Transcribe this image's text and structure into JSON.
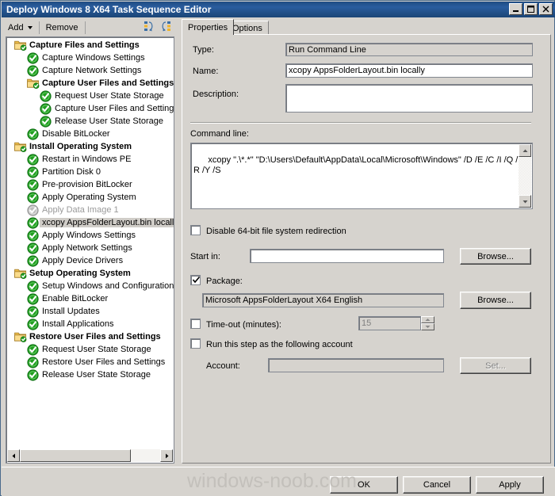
{
  "window": {
    "title": "Deploy Windows 8 X64 Task Sequence Editor",
    "minimize_label": "Minimize",
    "maximize_label": "Maximize",
    "close_label": "Close"
  },
  "toolbar": {
    "add_label": "Add",
    "remove_label": "Remove",
    "move_up_label": "Move Up",
    "move_down_label": "Move Down"
  },
  "tabs": [
    {
      "label": "Properties",
      "active": true
    },
    {
      "label": "Options",
      "active": false
    }
  ],
  "tree": {
    "items": [
      {
        "label": "Capture Files and Settings",
        "indent": 0,
        "icon": "folder-check-icon",
        "group": true,
        "state": "normal"
      },
      {
        "label": "Capture Windows Settings",
        "indent": 1,
        "icon": "green-check-icon",
        "group": false,
        "state": "normal"
      },
      {
        "label": "Capture Network Settings",
        "indent": 1,
        "icon": "green-check-icon",
        "group": false,
        "state": "normal"
      },
      {
        "label": "Capture User Files and Settings",
        "indent": 1,
        "icon": "folder-check-icon",
        "group": true,
        "state": "normal"
      },
      {
        "label": "Request User State Storage",
        "indent": 2,
        "icon": "green-check-icon",
        "group": false,
        "state": "normal"
      },
      {
        "label": "Capture User Files and Settings",
        "indent": 2,
        "icon": "green-check-icon",
        "group": false,
        "state": "normal"
      },
      {
        "label": "Release User State Storage",
        "indent": 2,
        "icon": "green-check-icon",
        "group": false,
        "state": "normal"
      },
      {
        "label": "Disable BitLocker",
        "indent": 1,
        "icon": "green-check-icon",
        "group": false,
        "state": "normal"
      },
      {
        "label": "Install Operating System",
        "indent": 0,
        "icon": "folder-check-icon",
        "group": true,
        "state": "normal"
      },
      {
        "label": "Restart in Windows PE",
        "indent": 1,
        "icon": "green-check-icon",
        "group": false,
        "state": "normal"
      },
      {
        "label": "Partition Disk 0",
        "indent": 1,
        "icon": "green-check-icon",
        "group": false,
        "state": "normal"
      },
      {
        "label": "Pre-provision BitLocker",
        "indent": 1,
        "icon": "green-check-icon",
        "group": false,
        "state": "normal"
      },
      {
        "label": "Apply Operating System",
        "indent": 1,
        "icon": "green-check-icon",
        "group": false,
        "state": "normal"
      },
      {
        "label": "Apply Data Image 1",
        "indent": 1,
        "icon": "gray-check-icon",
        "group": false,
        "state": "disabled"
      },
      {
        "label": "xcopy AppsFolderLayout.bin locally",
        "indent": 1,
        "icon": "green-check-icon",
        "group": false,
        "state": "selected"
      },
      {
        "label": "Apply Windows Settings",
        "indent": 1,
        "icon": "green-check-icon",
        "group": false,
        "state": "normal"
      },
      {
        "label": "Apply Network Settings",
        "indent": 1,
        "icon": "green-check-icon",
        "group": false,
        "state": "normal"
      },
      {
        "label": "Apply Device Drivers",
        "indent": 1,
        "icon": "green-check-icon",
        "group": false,
        "state": "normal"
      },
      {
        "label": "Setup Operating System",
        "indent": 0,
        "icon": "folder-check-icon",
        "group": true,
        "state": "normal"
      },
      {
        "label": "Setup Windows and Configuration",
        "indent": 1,
        "icon": "green-check-icon",
        "group": false,
        "state": "normal"
      },
      {
        "label": "Enable BitLocker",
        "indent": 1,
        "icon": "green-check-icon",
        "group": false,
        "state": "normal"
      },
      {
        "label": "Install Updates",
        "indent": 1,
        "icon": "green-check-icon",
        "group": false,
        "state": "normal"
      },
      {
        "label": "Install Applications",
        "indent": 1,
        "icon": "green-check-icon",
        "group": false,
        "state": "normal"
      },
      {
        "label": "Restore User Files and Settings",
        "indent": 0,
        "icon": "folder-check-icon",
        "group": true,
        "state": "normal"
      },
      {
        "label": "Request User State Storage",
        "indent": 1,
        "icon": "green-check-icon",
        "group": false,
        "state": "normal"
      },
      {
        "label": "Restore User Files and Settings",
        "indent": 1,
        "icon": "green-check-icon",
        "group": false,
        "state": "normal"
      },
      {
        "label": "Release User State Storage",
        "indent": 1,
        "icon": "green-check-icon",
        "group": false,
        "state": "normal"
      }
    ]
  },
  "properties": {
    "type_label": "Type:",
    "type_value": "Run Command Line",
    "name_label": "Name:",
    "name_value": "xcopy AppsFolderLayout.bin locally",
    "description_label": "Description:",
    "description_value": "",
    "command_line_label": "Command line:",
    "command_line_value": "xcopy \".\\*.*\" \"D:\\Users\\Default\\AppData\\Local\\Microsoft\\Windows\" /D /E /C /I /Q /H /R /Y /S",
    "disable_redirection_label": "Disable 64-bit file system redirection",
    "disable_redirection_checked": false,
    "start_in_label": "Start in:",
    "start_in_value": "",
    "start_in_browse_label": "Browse...",
    "package_label": "Package:",
    "package_checked": true,
    "package_value": "Microsoft AppsFolderLayout X64 English",
    "package_browse_label": "Browse...",
    "timeout_label": "Time-out (minutes):",
    "timeout_checked": false,
    "timeout_value": "15",
    "run_as_account_label": "Run this step as the following account",
    "run_as_account_checked": false,
    "account_label": "Account:",
    "account_value": "",
    "set_label": "Set..."
  },
  "footer": {
    "ok_label": "OK",
    "cancel_label": "Cancel",
    "apply_label": "Apply",
    "watermark": "windows-noob.com"
  },
  "colors": {
    "titlebar": "#2a5d9e",
    "dialog_face": "#d6d3ce",
    "check_green": "#18a018",
    "folder_yellow": "#f5cc63",
    "watermark": "#c3c0bb"
  }
}
